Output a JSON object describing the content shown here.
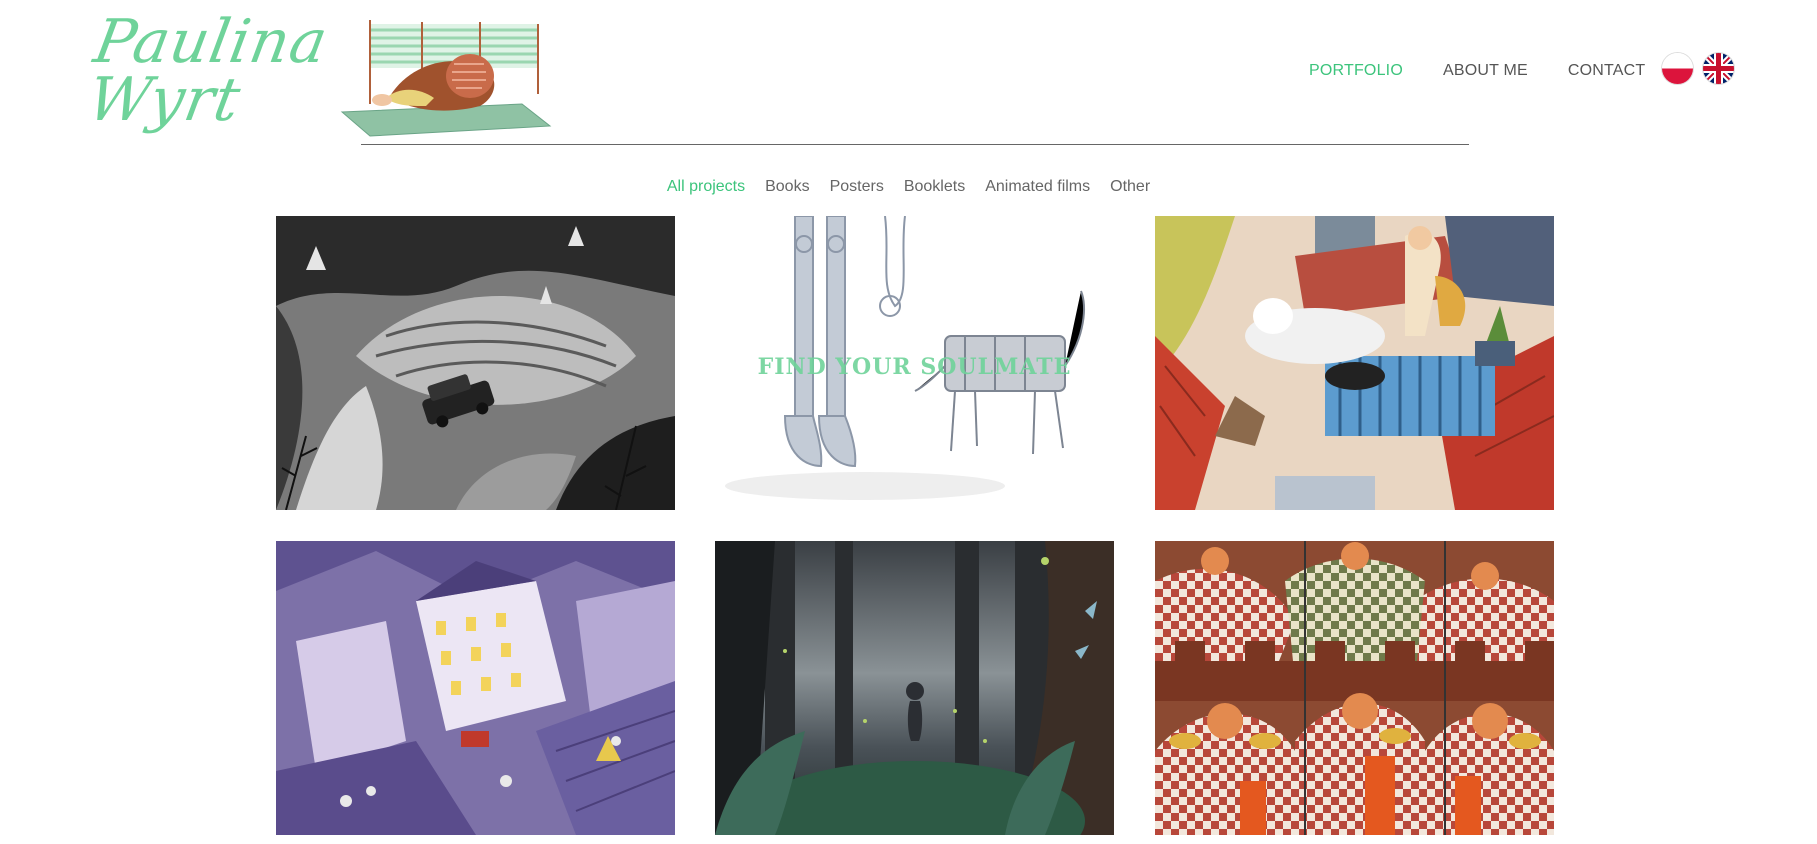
{
  "logo": {
    "line1": "Paulina",
    "line2": "Wyrt"
  },
  "nav": [
    {
      "label": "PORTFOLIO",
      "active": true
    },
    {
      "label": "ABOUT ME",
      "active": false
    },
    {
      "label": "CONTACT",
      "active": false
    }
  ],
  "languages": [
    {
      "code": "pl",
      "icon": "poland-flag-icon"
    },
    {
      "code": "en",
      "icon": "uk-flag-icon"
    }
  ],
  "filters": [
    {
      "label": "All projects",
      "active": true
    },
    {
      "label": "Books",
      "active": false
    },
    {
      "label": "Posters",
      "active": false
    },
    {
      "label": "Booklets",
      "active": false
    },
    {
      "label": "Animated films",
      "active": false
    },
    {
      "label": "Other",
      "active": false
    }
  ],
  "projects": [
    {
      "name": "bw-forest-car"
    },
    {
      "name": "find-your-soulmate",
      "overlay": "FIND YOUR SOULMATE"
    },
    {
      "name": "rooftop-dogs"
    },
    {
      "name": "purple-town"
    },
    {
      "name": "dark-forest"
    },
    {
      "name": "checkered-guards"
    }
  ],
  "colors": {
    "accent": "#3cc47c",
    "logo": "#6fd39a",
    "text": "#555555"
  }
}
